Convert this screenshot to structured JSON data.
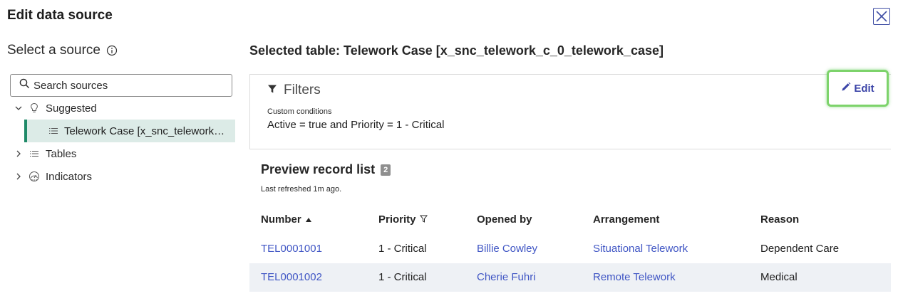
{
  "modal": {
    "title": "Edit data source"
  },
  "sidebar": {
    "heading": "Select a source",
    "search": {
      "placeholder": "Search sources",
      "value": ""
    },
    "tree": {
      "suggested": "Suggested",
      "selected_item": "Telework Case [x_snc_telework_c_0_telework_case]",
      "tables": "Tables",
      "indicators": "Indicators"
    }
  },
  "main": {
    "selected_table": "Selected table: Telework Case [x_snc_telework_c_0_telework_case]",
    "filters": {
      "title": "Filters",
      "subtitle": "Custom conditions",
      "condition": "Active = true and Priority = 1 - Critical",
      "edit_label": "Edit"
    },
    "preview": {
      "title": "Preview record list",
      "count": "2",
      "last_refreshed": "Last refreshed 1m ago.",
      "columns": [
        "Number",
        "Priority",
        "Opened by",
        "Arrangement",
        "Reason"
      ],
      "rows": [
        [
          "TEL0001001",
          "1 - Critical",
          "Billie Cowley",
          "Situational Telework",
          "Dependent Care"
        ],
        [
          "TEL0001002",
          "1 - Critical",
          "Cherie Fuhri",
          "Remote Telework",
          "Medical"
        ]
      ]
    }
  },
  "colors": {
    "accent": "#3c45a8",
    "link": "#3f55c4",
    "selected_bg": "#dcebe7",
    "selected_bar": "#1f8a68",
    "highlight": "#7dd36b"
  },
  "icons": {
    "close": "close-icon",
    "info": "info-icon",
    "search": "search-icon",
    "suggested": "lightbulb-icon",
    "list": "list-icon",
    "indicators": "indicator-icon",
    "filter": "funnel-icon",
    "edit": "pencil-icon",
    "sort": "sort-ascending-icon",
    "column_filter": "funnel-outline-icon"
  }
}
